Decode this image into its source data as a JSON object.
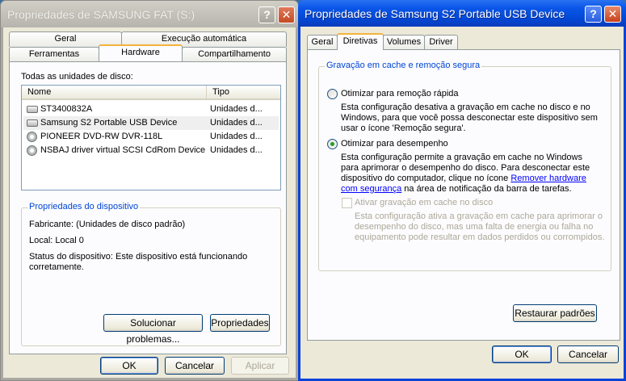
{
  "left_window": {
    "title": "Propriedades de SAMSUNG FAT (S:)",
    "help_glyph": "?",
    "close_glyph": "✕",
    "tabs_row1": [
      "Geral",
      "Execução automática"
    ],
    "tabs_row2": [
      "Ferramentas",
      "Hardware",
      "Compartilhamento"
    ],
    "active_tab": "Hardware",
    "disks_label": "Todas as unidades de disco:",
    "columns": [
      "Nome",
      "Tipo"
    ],
    "disks": [
      {
        "name": "ST3400832A",
        "type": "Unidades d...",
        "icon": "hard-drive-icon"
      },
      {
        "name": "Samsung S2 Portable USB Device",
        "type": "Unidades d...",
        "icon": "hard-drive-icon"
      },
      {
        "name": "PIONEER DVD-RW  DVR-118L",
        "type": "Unidades d...",
        "icon": "cd-drive-icon"
      },
      {
        "name": "NSBAJ driver virtual SCSI CdRom Device",
        "type": "Unidades d...",
        "icon": "cd-drive-icon"
      }
    ],
    "device_props": {
      "legend": "Propriedades do dispositivo",
      "manufacturer": "Fabricante: (Unidades de disco padrão)",
      "location": "Local: Local 0",
      "status_line1": "Status do dispositivo: Este dispositivo está funcionando",
      "status_line2": "corretamente."
    },
    "troubleshoot_button": "Solucionar problemas...",
    "properties_button": "Propriedades",
    "ok_button": "OK",
    "cancel_button": "Cancelar",
    "apply_button": "Aplicar"
  },
  "right_window": {
    "title": "Propriedades de Samsung S2 Portable USB Device",
    "help_glyph": "?",
    "close_glyph": "✕",
    "tabs": [
      "Geral",
      "Diretivas",
      "Volumes",
      "Driver"
    ],
    "active_tab": "Diretivas",
    "group_legend": "Gravação em cache e remoção segura",
    "option_quick": {
      "label": "Otimizar para remoção rápida",
      "desc": [
        "Esta configuração desativa a gravação em cache no disco e no",
        "Windows, para que você possa desconectar este dispositivo sem",
        "usar o ícone 'Remoção segura'."
      ]
    },
    "option_perf": {
      "label": "Otimizar para desempenho",
      "desc1": "Esta configuração permite a gravação em cache no Windows",
      "desc2": "para aprimorar o desempenho do disco. Para desconectar este",
      "desc3_pre": "dispositivo do computador, clique no ícone ",
      "link1": "Remover hardware",
      "link2": "com segurança",
      "desc4_post": " na área de notificação da barra de tarefas."
    },
    "cache_checkbox": {
      "label": "Ativar gravação em cache no disco",
      "desc": [
        "Esta configuração ativa a gravação em cache para aprimorar o",
        "desempenho do disco, mas uma falta de energia ou falha no",
        "equipamento pode resultar em dados perdidos ou corrompidos."
      ]
    },
    "restore_button": "Restaurar padrões",
    "ok_button": "OK",
    "cancel_button": "Cancelar"
  }
}
